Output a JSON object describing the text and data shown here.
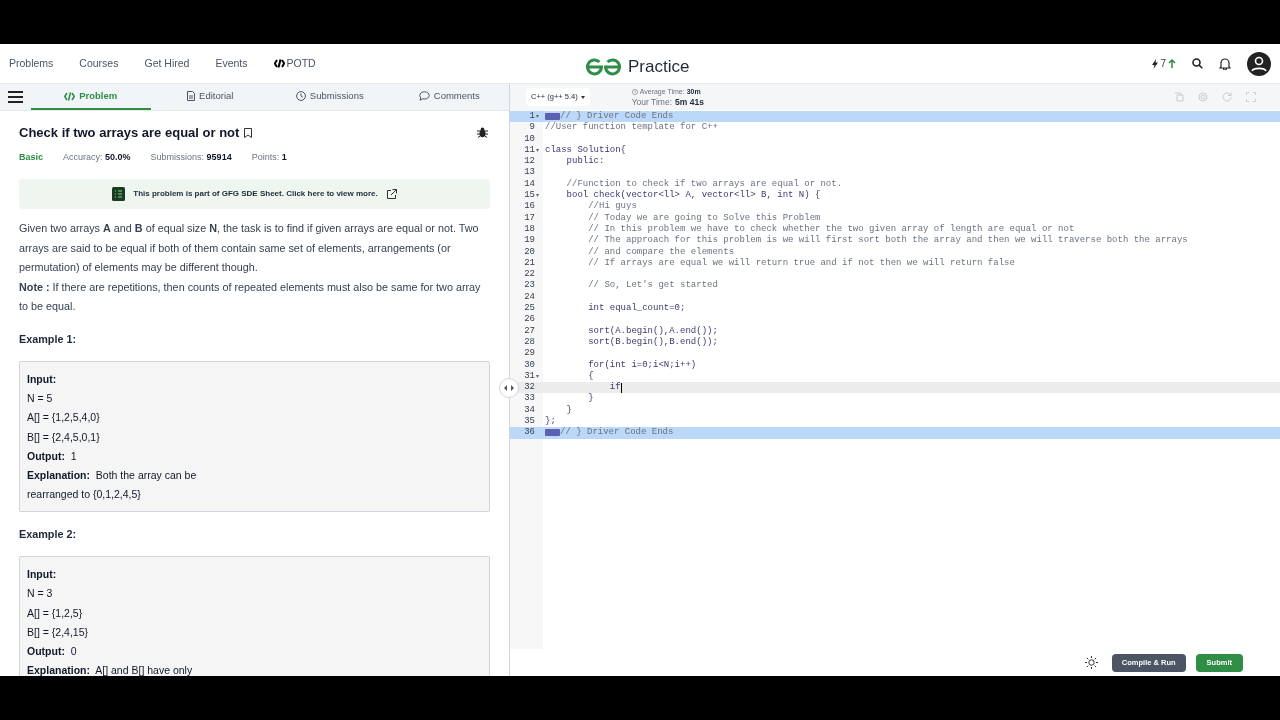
{
  "nav": {
    "links": [
      {
        "label": "Problems"
      },
      {
        "label": "Courses"
      },
      {
        "label": "Get Hired"
      },
      {
        "label": "Events"
      },
      {
        "label": "POTD",
        "code_icon": true
      }
    ],
    "logo": "Practice",
    "streak": "7"
  },
  "tabs": [
    {
      "label": "Problem",
      "selected": true
    },
    {
      "label": "Editorial",
      "selected": false
    },
    {
      "label": "Submissions",
      "selected": false
    },
    {
      "label": "Comments",
      "selected": false
    }
  ],
  "problem": {
    "title": "Check if two arrays are equal or not",
    "difficulty": "Basic",
    "stats": [
      {
        "label": "Accuracy:",
        "value": "50.0%"
      },
      {
        "label": "Submissions:",
        "value": "95914"
      },
      {
        "label": "Points:",
        "value": "1"
      }
    ],
    "banner": "This problem is part of GFG SDE Sheet. Click here to view more.",
    "description": "Given two arrays **A** and **B** of equal size **N**, the task is to find if given arrays are equal or not. Two arrays are said to be equal if both of them contain same set of elements, arrangements (or permutation) of elements may be different though.",
    "note": "**Note :** If there are repetitions, then counts of repeated elements must also be same for two array to be equal.",
    "examples": [
      {
        "title": "Example 1:",
        "lines": [
          "**Input:**",
          "N = 5",
          "A[] = {1,2,5,4,0}",
          "B[] = {2,4,5,0,1}",
          "**Output:**  1",
          "**Explanation:**  Both the array can be",
          "rearranged to {0,1,2,4,5}"
        ]
      },
      {
        "title": "Example 2:",
        "lines": [
          "**Input:**",
          "N = 3",
          "A[] = {1,2,5}",
          "B[] = {2,4,15}",
          "**Output:**  0",
          "**Explanation:**  A[] and B[] have only"
        ]
      }
    ]
  },
  "editor": {
    "language": "C++ (g++ 5.4)",
    "average_time_label": "Average Time:",
    "average_time": "30m",
    "your_time_label": "Your Time:",
    "your_time": "5m 41s",
    "lines": [
      {
        "number": "1",
        "text": "// } Driver Code Ends",
        "kind": "comment",
        "highlighted": true,
        "foldable": true,
        "folded_tag": true
      },
      {
        "number": "9",
        "text": "//User function template for C++",
        "kind": "comment"
      },
      {
        "number": "10"
      },
      {
        "number": "11",
        "text": "class Solution{",
        "kind": "code",
        "foldable": true
      },
      {
        "number": "12",
        "text": "    public:",
        "kind": "code"
      },
      {
        "number": "13"
      },
      {
        "number": "14",
        "text": "    //Function to check if two arrays are equal or not.",
        "kind": "comment"
      },
      {
        "number": "15",
        "text": "    bool check(vector<ll> A, vector<ll> B, int N) {",
        "kind": "code",
        "foldable": true
      },
      {
        "number": "16",
        "text": "        //Hi guys",
        "kind": "comment"
      },
      {
        "number": "17",
        "text": "        // Today we are going to Solve this Problem",
        "kind": "comment"
      },
      {
        "number": "18",
        "text": "        // In this problem we have to check whether the two given array of length are equal or not",
        "kind": "comment"
      },
      {
        "number": "19",
        "text": "        // The approach for this problem is we will first sort both the array and then we will traverse both the arrays",
        "kind": "comment"
      },
      {
        "number": "20",
        "text": "        // and compare the elements",
        "kind": "comment"
      },
      {
        "number": "21",
        "text": "        // If arrays are equal we will return true and if not then we will return false",
        "kind": "comment"
      },
      {
        "number": "22"
      },
      {
        "number": "23",
        "text": "        // So, Let's get started",
        "kind": "comment"
      },
      {
        "number": "24"
      },
      {
        "number": "25",
        "text": "        int equal_count=0;",
        "kind": "code"
      },
      {
        "number": "26"
      },
      {
        "number": "27",
        "text": "        sort(A.begin(),A.end());",
        "kind": "code"
      },
      {
        "number": "28",
        "text": "        sort(B.begin(),B.end());",
        "kind": "code"
      },
      {
        "number": "29"
      },
      {
        "number": "30",
        "text": "        for(int i=0;i<N;i++)",
        "kind": "code"
      },
      {
        "number": "31",
        "text": "        {",
        "kind": "code",
        "foldable": true
      },
      {
        "number": "32",
        "text": "            if",
        "kind": "code",
        "active": true
      },
      {
        "number": "33",
        "text": "        }",
        "kind": "code"
      },
      {
        "number": "34",
        "text": "    }",
        "kind": "code"
      },
      {
        "number": "35",
        "text": "};",
        "kind": "code"
      },
      {
        "number": "36",
        "text": "// } Driver Code Ends",
        "kind": "comment",
        "highlighted": true,
        "folded_tag": true
      }
    ]
  },
  "footer": {
    "compile_button": "Compile & Run",
    "submit_button": "Submit"
  }
}
